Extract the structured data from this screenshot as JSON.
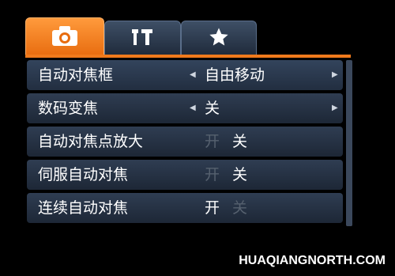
{
  "tabs": [
    {
      "icon": "camera-icon",
      "active": true
    },
    {
      "icon": "wrench-settings-icon",
      "active": false
    },
    {
      "icon": "star-icon",
      "active": false
    }
  ],
  "colors": {
    "accent": "#f07a1c",
    "row_bg": "#2a374a",
    "dim_option": "#56616f"
  },
  "menu": {
    "rows": [
      {
        "label": "自动对焦框",
        "value": "自由移动"
      },
      {
        "label": "数码变焦",
        "value": "关"
      },
      {
        "label": "自动对焦点放大",
        "opt_on": "开",
        "opt_off": "关",
        "selected": "关"
      },
      {
        "label": "伺服自动对焦",
        "opt_on": "开",
        "opt_off": "关",
        "selected": "关"
      },
      {
        "label": "连续自动对焦",
        "opt_on": "开",
        "opt_off": "关",
        "selected": "开"
      }
    ]
  },
  "watermark": "HUAQIANGNORTH.COM"
}
